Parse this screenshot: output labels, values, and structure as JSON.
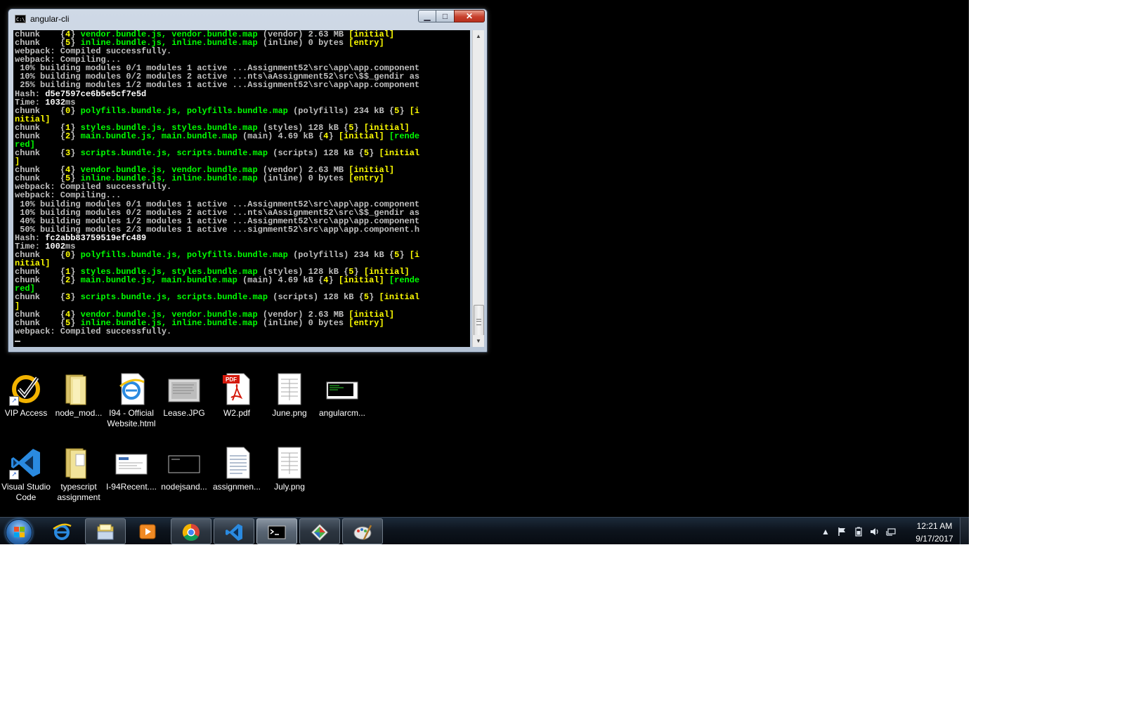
{
  "window": {
    "title": "angular-cli",
    "minimize_label": "▁",
    "maximize_label": "□",
    "close_label": "✕",
    "console_icon_text": "C:\\_"
  },
  "console": {
    "lines": [
      [
        {
          "t": "chunk    {",
          "c": "w"
        },
        {
          "t": "4",
          "c": "y"
        },
        {
          "t": "} ",
          "c": "w"
        },
        {
          "t": "vendor.bundle.js, vendor.bundle.map",
          "c": "g"
        },
        {
          "t": " (vendor) 2.63 MB ",
          "c": "w"
        },
        {
          "t": "[initial]",
          "c": "y"
        }
      ],
      [
        {
          "t": "chunk    {",
          "c": "w"
        },
        {
          "t": "5",
          "c": "y"
        },
        {
          "t": "} ",
          "c": "w"
        },
        {
          "t": "inline.bundle.js, inline.bundle.map",
          "c": "g"
        },
        {
          "t": " (inline) 0 bytes ",
          "c": "w"
        },
        {
          "t": "[entry]",
          "c": "y"
        }
      ],
      [
        {
          "t": "webpack: Compiled successfully.",
          "c": "w"
        }
      ],
      [
        {
          "t": "webpack: Compiling...",
          "c": "w"
        }
      ],
      [
        {
          "t": " 10% building modules 0/1 modules 1 active ...Assignment52\\src\\app\\app.component",
          "c": "w"
        }
      ],
      [
        {
          "t": " 10% building modules 0/2 modules 2 active ...nts\\aAssignment52\\src\\$$_gendir as",
          "c": "w"
        }
      ],
      [
        {
          "t": " 25% building modules 1/2 modules 1 active ...Assignment52\\src\\app\\app.component",
          "c": "w"
        }
      ],
      [
        {
          "t": "Hash: ",
          "c": "w"
        },
        {
          "t": "d5e7597ce6b5e5cf7e5d",
          "c": "b"
        }
      ],
      [
        {
          "t": "Time: ",
          "c": "w"
        },
        {
          "t": "1032",
          "c": "b"
        },
        {
          "t": "ms",
          "c": "w"
        }
      ],
      [
        {
          "t": "chunk    {",
          "c": "w"
        },
        {
          "t": "0",
          "c": "y"
        },
        {
          "t": "} ",
          "c": "w"
        },
        {
          "t": "polyfills.bundle.js, polyfills.bundle.map",
          "c": "g"
        },
        {
          "t": " (polyfills) 234 kB {",
          "c": "w"
        },
        {
          "t": "5",
          "c": "y"
        },
        {
          "t": "} ",
          "c": "w"
        },
        {
          "t": "[i",
          "c": "y"
        }
      ],
      [
        {
          "t": "nitial]",
          "c": "y"
        }
      ],
      [
        {
          "t": "chunk    {",
          "c": "w"
        },
        {
          "t": "1",
          "c": "y"
        },
        {
          "t": "} ",
          "c": "w"
        },
        {
          "t": "styles.bundle.js, styles.bundle.map",
          "c": "g"
        },
        {
          "t": " (styles) 128 kB {",
          "c": "w"
        },
        {
          "t": "5",
          "c": "y"
        },
        {
          "t": "} ",
          "c": "w"
        },
        {
          "t": "[initial]",
          "c": "y"
        }
      ],
      [
        {
          "t": "chunk    {",
          "c": "w"
        },
        {
          "t": "2",
          "c": "y"
        },
        {
          "t": "} ",
          "c": "w"
        },
        {
          "t": "main.bundle.js, main.bundle.map",
          "c": "g"
        },
        {
          "t": " (main) 4.69 kB {",
          "c": "w"
        },
        {
          "t": "4",
          "c": "y"
        },
        {
          "t": "} ",
          "c": "w"
        },
        {
          "t": "[initial]",
          "c": "y"
        },
        {
          "t": " [rende",
          "c": "g"
        }
      ],
      [
        {
          "t": "red]",
          "c": "g"
        }
      ],
      [
        {
          "t": "chunk    {",
          "c": "w"
        },
        {
          "t": "3",
          "c": "y"
        },
        {
          "t": "} ",
          "c": "w"
        },
        {
          "t": "scripts.bundle.js, scripts.bundle.map",
          "c": "g"
        },
        {
          "t": " (scripts) 128 kB {",
          "c": "w"
        },
        {
          "t": "5",
          "c": "y"
        },
        {
          "t": "} ",
          "c": "w"
        },
        {
          "t": "[initial",
          "c": "y"
        }
      ],
      [
        {
          "t": "]",
          "c": "y"
        }
      ],
      [
        {
          "t": "chunk    {",
          "c": "w"
        },
        {
          "t": "4",
          "c": "y"
        },
        {
          "t": "} ",
          "c": "w"
        },
        {
          "t": "vendor.bundle.js, vendor.bundle.map",
          "c": "g"
        },
        {
          "t": " (vendor) 2.63 MB ",
          "c": "w"
        },
        {
          "t": "[initial]",
          "c": "y"
        }
      ],
      [
        {
          "t": "chunk    {",
          "c": "w"
        },
        {
          "t": "5",
          "c": "y"
        },
        {
          "t": "} ",
          "c": "w"
        },
        {
          "t": "inline.bundle.js, inline.bundle.map",
          "c": "g"
        },
        {
          "t": " (inline) 0 bytes ",
          "c": "w"
        },
        {
          "t": "[entry]",
          "c": "y"
        }
      ],
      [
        {
          "t": "webpack: Compiled successfully.",
          "c": "w"
        }
      ],
      [
        {
          "t": "webpack: Compiling...",
          "c": "w"
        }
      ],
      [
        {
          "t": " 10% building modules 0/1 modules 1 active ...Assignment52\\src\\app\\app.component",
          "c": "w"
        }
      ],
      [
        {
          "t": " 10% building modules 0/2 modules 2 active ...nts\\aAssignment52\\src\\$$_gendir as",
          "c": "w"
        }
      ],
      [
        {
          "t": " 40% building modules 1/2 modules 1 active ...Assignment52\\src\\app\\app.component",
          "c": "w"
        }
      ],
      [
        {
          "t": " 50% building modules 2/3 modules 1 active ...signment52\\src\\app\\app.component.h",
          "c": "w"
        }
      ],
      [
        {
          "t": "Hash: ",
          "c": "w"
        },
        {
          "t": "fc2abb83759519efc489",
          "c": "b"
        }
      ],
      [
        {
          "t": "Time: ",
          "c": "w"
        },
        {
          "t": "1002",
          "c": "b"
        },
        {
          "t": "ms",
          "c": "w"
        }
      ],
      [
        {
          "t": "chunk    {",
          "c": "w"
        },
        {
          "t": "0",
          "c": "y"
        },
        {
          "t": "} ",
          "c": "w"
        },
        {
          "t": "polyfills.bundle.js, polyfills.bundle.map",
          "c": "g"
        },
        {
          "t": " (polyfills) 234 kB {",
          "c": "w"
        },
        {
          "t": "5",
          "c": "y"
        },
        {
          "t": "} ",
          "c": "w"
        },
        {
          "t": "[i",
          "c": "y"
        }
      ],
      [
        {
          "t": "nitial]",
          "c": "y"
        }
      ],
      [
        {
          "t": "chunk    {",
          "c": "w"
        },
        {
          "t": "1",
          "c": "y"
        },
        {
          "t": "} ",
          "c": "w"
        },
        {
          "t": "styles.bundle.js, styles.bundle.map",
          "c": "g"
        },
        {
          "t": " (styles) 128 kB {",
          "c": "w"
        },
        {
          "t": "5",
          "c": "y"
        },
        {
          "t": "} ",
          "c": "w"
        },
        {
          "t": "[initial]",
          "c": "y"
        }
      ],
      [
        {
          "t": "chunk    {",
          "c": "w"
        },
        {
          "t": "2",
          "c": "y"
        },
        {
          "t": "} ",
          "c": "w"
        },
        {
          "t": "main.bundle.js, main.bundle.map",
          "c": "g"
        },
        {
          "t": " (main) 4.69 kB {",
          "c": "w"
        },
        {
          "t": "4",
          "c": "y"
        },
        {
          "t": "} ",
          "c": "w"
        },
        {
          "t": "[initial]",
          "c": "y"
        },
        {
          "t": " [rende",
          "c": "g"
        }
      ],
      [
        {
          "t": "red]",
          "c": "g"
        }
      ],
      [
        {
          "t": "chunk    {",
          "c": "w"
        },
        {
          "t": "3",
          "c": "y"
        },
        {
          "t": "} ",
          "c": "w"
        },
        {
          "t": "scripts.bundle.js, scripts.bundle.map",
          "c": "g"
        },
        {
          "t": " (scripts) 128 kB {",
          "c": "w"
        },
        {
          "t": "5",
          "c": "y"
        },
        {
          "t": "} ",
          "c": "w"
        },
        {
          "t": "[initial",
          "c": "y"
        }
      ],
      [
        {
          "t": "]",
          "c": "y"
        }
      ],
      [
        {
          "t": "chunk    {",
          "c": "w"
        },
        {
          "t": "4",
          "c": "y"
        },
        {
          "t": "} ",
          "c": "w"
        },
        {
          "t": "vendor.bundle.js, vendor.bundle.map",
          "c": "g"
        },
        {
          "t": " (vendor) 2.63 MB ",
          "c": "w"
        },
        {
          "t": "[initial]",
          "c": "y"
        }
      ],
      [
        {
          "t": "chunk    {",
          "c": "w"
        },
        {
          "t": "5",
          "c": "y"
        },
        {
          "t": "} ",
          "c": "w"
        },
        {
          "t": "inline.bundle.js, inline.bundle.map",
          "c": "g"
        },
        {
          "t": " (inline) 0 bytes ",
          "c": "w"
        },
        {
          "t": "[entry]",
          "c": "y"
        }
      ],
      [
        {
          "t": "webpack: Compiled successfully.",
          "c": "w"
        }
      ]
    ]
  },
  "desktop": {
    "icons_row1": [
      {
        "label": "VIP Access",
        "icon": "vip-access-icon"
      },
      {
        "label": "node_mod...",
        "icon": "folder-icon"
      },
      {
        "label": "I94 - Official Website.html",
        "icon": "internet-explorer-document-icon"
      },
      {
        "label": "Lease.JPG",
        "icon": "image-thumbnail-icon"
      },
      {
        "label": "W2.pdf",
        "icon": "pdf-icon"
      },
      {
        "label": "June.png",
        "icon": "image-thumbnail-icon"
      },
      {
        "label": "angularcm...",
        "icon": "image-thumbnail-icon"
      }
    ],
    "icons_row2": [
      {
        "label": "Visual Studio Code",
        "icon": "vscode-icon"
      },
      {
        "label": "typescript assignment",
        "icon": "folder-icon"
      },
      {
        "label": "I-94Recent....",
        "icon": "image-thumbnail-icon"
      },
      {
        "label": "nodejsand...",
        "icon": "image-thumbnail-icon"
      },
      {
        "label": "assignmen...",
        "icon": "text-document-icon"
      },
      {
        "label": "July.png",
        "icon": "image-thumbnail-icon"
      }
    ]
  },
  "taskbar": {
    "buttons": [
      {
        "name": "internet-explorer-icon",
        "state": "pinned"
      },
      {
        "name": "file-explorer-icon",
        "state": "open"
      },
      {
        "name": "media-player-icon",
        "state": "pinned"
      },
      {
        "name": "chrome-icon",
        "state": "open"
      },
      {
        "name": "vscode-icon",
        "state": "open"
      },
      {
        "name": "command-prompt-icon",
        "state": "active"
      },
      {
        "name": "gitkraken-icon",
        "state": "open"
      },
      {
        "name": "paint-icon",
        "state": "open"
      }
    ],
    "tray": {
      "show_hidden_label": "▲",
      "time": "12:21 AM",
      "date": "9/17/2017"
    }
  }
}
